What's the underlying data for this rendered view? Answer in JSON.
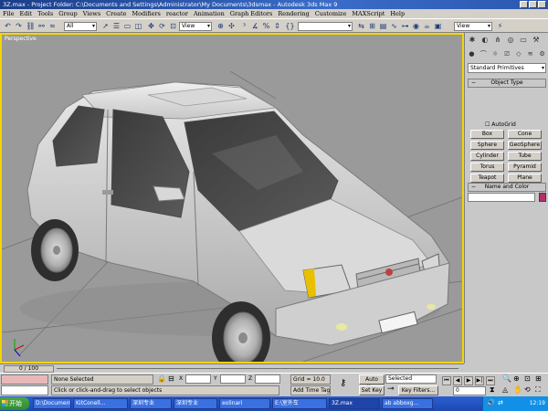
{
  "window": {
    "title": "3Z.max    - Project Folder: C:\\Documents and Settings\\Administrator\\My Documents\\3dsmax    - Autodesk 3ds Max 9"
  },
  "menu": [
    "File",
    "Edit",
    "Tools",
    "Group",
    "Views",
    "Create",
    "Modifiers",
    "reactor",
    "Animation",
    "Graph Editors",
    "Rendering",
    "Customize",
    "MAXScript",
    "Help"
  ],
  "toolbar": {
    "selection_filter": "All",
    "ref_coord": "View",
    "named_selection": "",
    "right_view": "View"
  },
  "viewport": {
    "label": "Perspective",
    "border_color": "#f4d600"
  },
  "command_panel": {
    "category": "Standard Primitives",
    "object_type_header": "Object Type",
    "autogrid": "AutoGrid",
    "objects": [
      "Box",
      "Cone",
      "Sphere",
      "GeoSphere",
      "Cylinder",
      "Tube",
      "Torus",
      "Pyramid",
      "Teapot",
      "Plane"
    ],
    "name_color_header": "Name and Color",
    "name_value": "",
    "color": "#b0306a"
  },
  "timeline": {
    "frame_label": "0 / 100"
  },
  "status": {
    "selection": "None Selected",
    "prompt": "Click or click-and-drag to select objects",
    "x_label": "X",
    "y_label": "Y",
    "z_label": "Z",
    "grid": "Grid = 10.0",
    "add_time_tag": "Add Time Tag",
    "auto_key": "Auto Key",
    "set_key": "Set Key",
    "key_mode": "Selected",
    "key_filters": "Key Filters...",
    "frame_field": "0"
  },
  "taskbar": {
    "start": "开始",
    "tasks": [
      "D:\\Documents and...",
      "KitConell...",
      "深圳专业",
      "深圳专业",
      "eolinari",
      "E:\\室外车",
      "3Z.max",
      "ab abboxg..."
    ],
    "clock": "12:19"
  }
}
